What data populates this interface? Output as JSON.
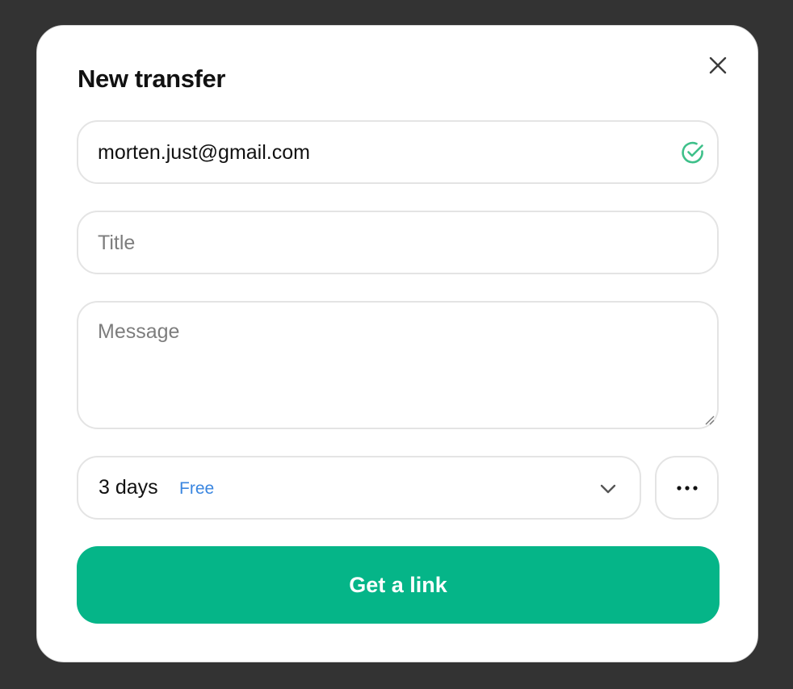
{
  "modal": {
    "title": "New transfer"
  },
  "form": {
    "email": {
      "value": "morten.just@gmail.com",
      "status_icon": "check-circle-icon"
    },
    "title": {
      "value": "",
      "placeholder": "Title"
    },
    "message": {
      "value": "",
      "placeholder": "Message"
    },
    "expiry": {
      "selected": "3 days",
      "badge": "Free"
    }
  },
  "actions": {
    "submit_label": "Get a link",
    "more_icon": "ellipsis-icon",
    "close_icon": "close-icon"
  },
  "colors": {
    "backdrop": "#333333",
    "primary": "#05b588",
    "check": "#3ec08a",
    "badge": "#3a86e0"
  }
}
